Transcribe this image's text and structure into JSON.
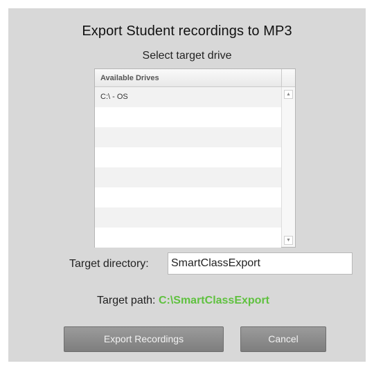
{
  "dialog": {
    "title": "Export Student recordings to MP3",
    "subtitle": "Select target drive"
  },
  "drives": {
    "header": "Available Drives",
    "items": [
      "C:\\ - OS",
      "",
      "",
      "",
      "",
      "",
      "",
      ""
    ]
  },
  "target": {
    "directory_label": "Target directory:",
    "directory_value": "SmartClassExport",
    "path_label": "Target path:",
    "path_value": "C:\\SmartClassExport"
  },
  "buttons": {
    "export_label": "Export Recordings",
    "cancel_label": "Cancel"
  },
  "colors": {
    "path_value": "#5fc13f",
    "dialog_bg": "#d8d8d8",
    "button_bg": "#8c8c8c"
  }
}
